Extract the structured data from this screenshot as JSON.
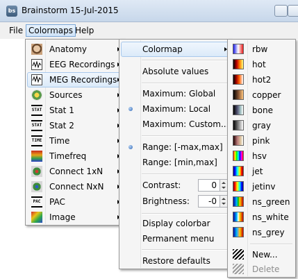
{
  "window": {
    "title": "Brainstorm 15-Jul-2015",
    "app_icon": "bs-logo-icon"
  },
  "menubar": {
    "items": [
      "File",
      "Colormaps",
      "Help"
    ]
  },
  "colormaps_menu": {
    "items": [
      {
        "label": "Anatomy",
        "icon": "anatomy-icon"
      },
      {
        "label": "EEG Recordings",
        "icon": "eeg-icon"
      },
      {
        "label": "MEG Recordings",
        "icon": "meg-icon"
      },
      {
        "label": "Sources",
        "icon": "sources-icon"
      },
      {
        "label": "Stat 1",
        "icon": "stat-icon",
        "icon_text": "STAT"
      },
      {
        "label": "Stat 2",
        "icon": "stat-icon",
        "icon_text": "STAT"
      },
      {
        "label": "Time",
        "icon": "time-icon",
        "icon_text": "TIME"
      },
      {
        "label": "Timefreq",
        "icon": "timefreq-icon"
      },
      {
        "label": "Connect 1xN",
        "icon": "connect-icon"
      },
      {
        "label": "Connect NxN",
        "icon": "connect-icon"
      },
      {
        "label": "PAC",
        "icon": "pac-icon",
        "icon_text": "PAC"
      },
      {
        "label": "Image",
        "icon": "image-icon"
      }
    ]
  },
  "meg_submenu": {
    "colormap": "Colormap",
    "absolute": "Absolute values",
    "max_global": "Maximum: Global",
    "max_local": "Maximum: Local",
    "max_custom": "Maximum: Custom...",
    "range_sym": "Range: [-max,max]",
    "range_minmax": "Range: [min,max]",
    "contrast_label": "Contrast:",
    "contrast_value": "0",
    "brightness_label": "Brightness:",
    "brightness_value": "-0",
    "display_colorbar": "Display colorbar",
    "permanent_menu": "Permanent menu",
    "restore_defaults": "Restore defaults"
  },
  "colormap_list": {
    "items": [
      "rbw",
      "hot",
      "hot2",
      "copper",
      "bone",
      "gray",
      "pink",
      "hsv",
      "jet",
      "jetinv",
      "ns_green",
      "ns_white",
      "ns_grey"
    ],
    "new_label": "New...",
    "delete_label": "Delete"
  }
}
